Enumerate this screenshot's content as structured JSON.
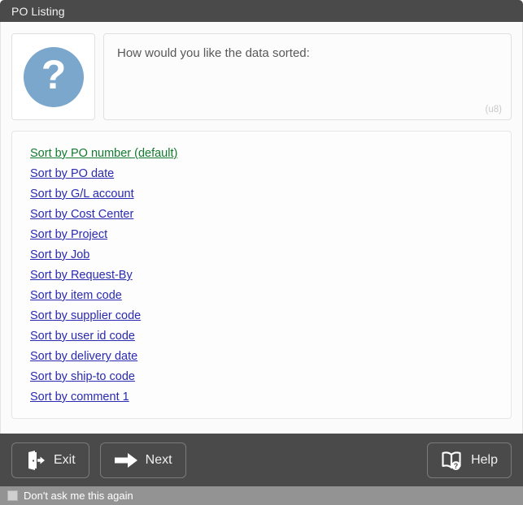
{
  "window": {
    "title": "PO Listing"
  },
  "prompt": {
    "icon": "question-mark-icon",
    "text": "How would you like the data sorted:",
    "hint": "(u8)"
  },
  "sort_options": [
    {
      "label": "Sort by PO number (default)",
      "style": "default"
    },
    {
      "label": "Sort by PO date",
      "style": "normal"
    },
    {
      "label": "Sort by G/L account",
      "style": "normal"
    },
    {
      "label": "Sort by Cost Center",
      "style": "normal"
    },
    {
      "label": "Sort by Project",
      "style": "normal"
    },
    {
      "label": "Sort by Job",
      "style": "normal"
    },
    {
      "label": "Sort by Request-By",
      "style": "normal"
    },
    {
      "label": "Sort by item code",
      "style": "normal"
    },
    {
      "label": "Sort by supplier code",
      "style": "normal"
    },
    {
      "label": "Sort by user id code",
      "style": "normal"
    },
    {
      "label": "Sort by delivery date",
      "style": "normal"
    },
    {
      "label": "Sort by ship-to code",
      "style": "normal"
    },
    {
      "label": "Sort by comment 1",
      "style": "normal"
    }
  ],
  "buttons": {
    "exit": {
      "label": "Exit",
      "icon": "exit-door-icon"
    },
    "next": {
      "label": "Next",
      "icon": "arrow-right-icon"
    },
    "help": {
      "label": "Help",
      "icon": "book-help-icon"
    }
  },
  "footer": {
    "checkbox_label": "Don't ask me this again",
    "checked": false
  },
  "colors": {
    "titlebar": "#4a4a4a",
    "buttonbar": "#4a4a4a",
    "footer": "#939393",
    "icon_blue": "#7ba7cc",
    "link": "#2a2ab0",
    "default_link": "#117a2e"
  }
}
